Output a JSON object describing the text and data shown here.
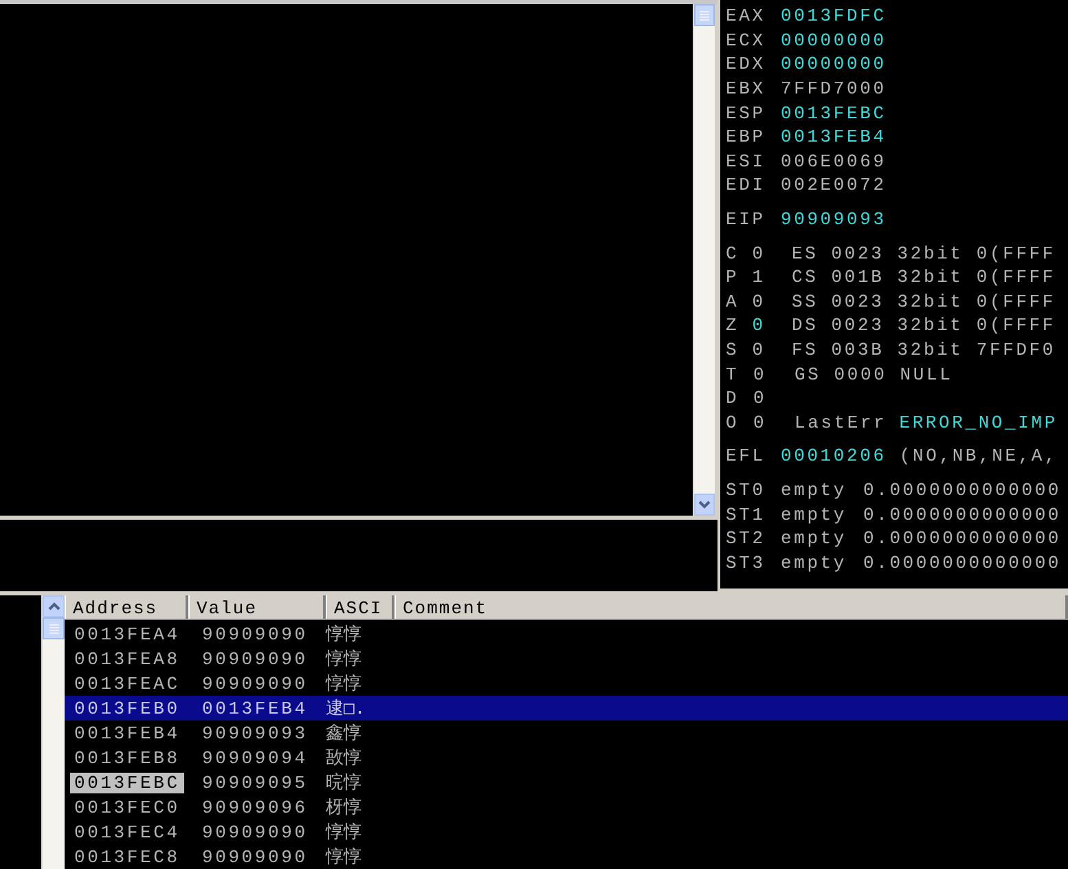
{
  "registers": [
    {
      "name": "EAX",
      "value": "0013FDFC",
      "changed": true
    },
    {
      "name": "ECX",
      "value": "00000000",
      "changed": true
    },
    {
      "name": "EDX",
      "value": "00000000",
      "changed": true
    },
    {
      "name": "EBX",
      "value": "7FFD7000",
      "changed": false
    },
    {
      "name": "ESP",
      "value": "0013FEBC",
      "changed": true
    },
    {
      "name": "EBP",
      "value": "0013FEB4",
      "changed": true
    },
    {
      "name": "ESI",
      "value": "006E0069",
      "changed": false
    },
    {
      "name": "EDI",
      "value": "002E0072",
      "changed": false
    }
  ],
  "eip": {
    "name": "EIP",
    "value": "90909093",
    "changed": true
  },
  "flags": [
    {
      "flag": "C",
      "value": "0",
      "changed": false,
      "detail": "ES 0023 32bit 0(FFFF"
    },
    {
      "flag": "P",
      "value": "1",
      "changed": false,
      "detail": "CS 001B 32bit 0(FFFF"
    },
    {
      "flag": "A",
      "value": "0",
      "changed": false,
      "detail": "SS 0023 32bit 0(FFFF"
    },
    {
      "flag": "Z",
      "value": "0",
      "changed": true,
      "detail": "DS 0023 32bit 0(FFFF"
    },
    {
      "flag": "S",
      "value": "0",
      "changed": false,
      "detail": "FS 003B 32bit 7FFDF0"
    },
    {
      "flag": "T",
      "value": "0",
      "changed": false,
      "detail": "GS 0000 NULL"
    },
    {
      "flag": "D",
      "value": "0",
      "changed": false
    },
    {
      "flag": "O",
      "value": "0",
      "changed": false,
      "detail": "LastErr",
      "detail_value": "ERROR_NO_IMP",
      "detail_changed": true
    }
  ],
  "efl": {
    "name": "EFL",
    "value": "00010206",
    "changed": true,
    "detail": "(NO,NB,NE,A,"
  },
  "fpu": [
    {
      "name": "ST0",
      "tag": "empty",
      "value": "0.0000000000000"
    },
    {
      "name": "ST1",
      "tag": "empty",
      "value": "0.0000000000000"
    },
    {
      "name": "ST2",
      "tag": "empty",
      "value": "0.0000000000000"
    },
    {
      "name": "ST3",
      "tag": "empty",
      "value": "0.0000000000000"
    }
  ],
  "stack": {
    "columns": [
      "Address",
      "Value",
      "ASCI",
      "Comment"
    ],
    "rows": [
      {
        "address": "0013FEA4",
        "value": "90909090",
        "ascii": "惇惇",
        "selected": false,
        "esp": false
      },
      {
        "address": "0013FEA8",
        "value": "90909090",
        "ascii": "惇惇",
        "selected": false,
        "esp": false
      },
      {
        "address": "0013FEAC",
        "value": "90909090",
        "ascii": "惇惇",
        "selected": false,
        "esp": false
      },
      {
        "address": "0013FEB0",
        "value": "0013FEB4",
        "ascii": "逮□.",
        "selected": true,
        "esp": false
      },
      {
        "address": "0013FEB4",
        "value": "90909093",
        "ascii": "鑫惇",
        "selected": false,
        "esp": false
      },
      {
        "address": "0013FEB8",
        "value": "90909094",
        "ascii": "敔惇",
        "selected": false,
        "esp": false
      },
      {
        "address": "0013FEBC",
        "value": "90909095",
        "ascii": "晥惇",
        "selected": false,
        "esp": true
      },
      {
        "address": "0013FEC0",
        "value": "90909096",
        "ascii": "枒惇",
        "selected": false,
        "esp": false
      },
      {
        "address": "0013FEC4",
        "value": "90909090",
        "ascii": "惇惇",
        "selected": false,
        "esp": false
      },
      {
        "address": "0013FEC8",
        "value": "90909090",
        "ascii": "惇惇",
        "selected": false,
        "esp": false
      }
    ]
  }
}
